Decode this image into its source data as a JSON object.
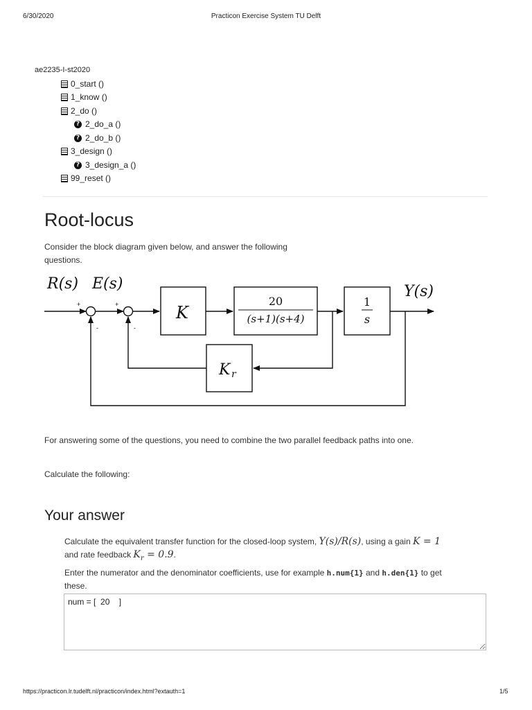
{
  "header": {
    "date": "6/30/2020",
    "title": "Practicon Exercise System TU Delft"
  },
  "footer": {
    "url": "https://practicon.lr.tudelft.nl/practicon/index.html?extauth=1",
    "page": "1/5"
  },
  "tree": {
    "root": "ae2235-I-st2020",
    "items": [
      {
        "label": "0_start ()",
        "icon": "page-icon",
        "level": 1
      },
      {
        "label": "1_know ()",
        "icon": "page-icon",
        "level": 1
      },
      {
        "label": "2_do ()",
        "icon": "page-icon",
        "level": 1
      },
      {
        "label": "2_do_a ()",
        "icon": "question-icon",
        "level": 2
      },
      {
        "label": "2_do_b ()",
        "icon": "question-icon",
        "level": 2
      },
      {
        "label": "3_design ()",
        "icon": "page-icon",
        "level": 1
      },
      {
        "label": "3_design_a ()",
        "icon": "question-icon",
        "level": 2
      },
      {
        "label": "99_reset ()",
        "icon": "page-icon",
        "level": 1
      }
    ]
  },
  "main": {
    "title": "Root-locus",
    "intro_line1": "Consider the block diagram given below, and answer the following",
    "intro_line2": "questions.",
    "paragraph2": "For answering some of the questions, you need to combine the two parallel feedback paths into one.",
    "paragraph3": "Calculate the following:"
  },
  "diagram": {
    "input_label": "R(s)",
    "error_label": "E(s)",
    "output_label": "Y(s)",
    "gain_block": "K",
    "plant_num": "20",
    "plant_den": "(s+1)(s+4)",
    "integrator_num": "1",
    "integrator_den": "s",
    "feedback_block": "K",
    "feedback_sub": "r",
    "plus": "+",
    "minus": "-"
  },
  "answer": {
    "heading": "Your answer",
    "q_part1": "Calculate the equivalent transfer function for the closed-loop system,",
    "q_math1": "Y(s)/R(s)",
    "q_part2": ", using a gain",
    "q_math2": "K = 1",
    "q_part3": "and rate feedback",
    "q_math3": "K",
    "q_math3_sub": "r",
    "q_math3_val": " = 0.9",
    "q_part4": ".",
    "instr_part1": "Enter the numerator and the denominator coefficients, use for example",
    "code1": "h.num{1}",
    "instr_and": "and",
    "code2": "h.den{1}",
    "instr_part2": "to get",
    "instr_part3": "these.",
    "input_value": "num = [  20    ]"
  }
}
